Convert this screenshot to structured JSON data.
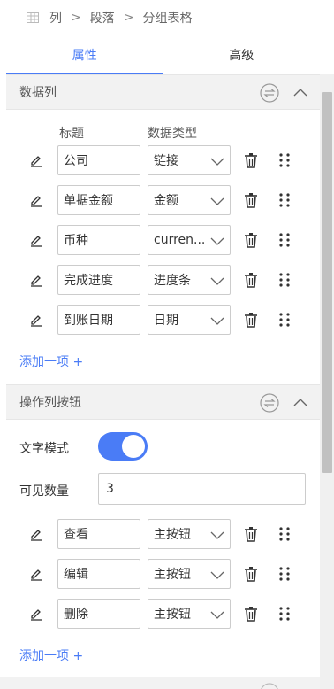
{
  "breadcrumb": {
    "items": [
      "列",
      "段落",
      "分组表格"
    ],
    "separator": ">"
  },
  "tabs": [
    {
      "label": "属性",
      "active": true
    },
    {
      "label": "高级",
      "active": false
    }
  ],
  "data_columns": {
    "title": "数据列",
    "header_title": "标题",
    "header_type": "数据类型",
    "rows": [
      {
        "title": "公司",
        "type": "链接"
      },
      {
        "title": "单据金额",
        "type": "金额"
      },
      {
        "title": "币种",
        "type": "curren..."
      },
      {
        "title": "完成进度",
        "type": "进度条"
      },
      {
        "title": "到账日期",
        "type": "日期"
      }
    ],
    "add_label": "添加一项 +"
  },
  "action_buttons": {
    "title": "操作列按钮",
    "text_mode_label": "文字模式",
    "text_mode_on": true,
    "visible_count_label": "可见数量",
    "visible_count_value": "3",
    "rows": [
      {
        "title": "查看",
        "type": "主按钮"
      },
      {
        "title": "编辑",
        "type": "主按钮"
      },
      {
        "title": "删除",
        "type": "主按钮"
      }
    ],
    "add_label": "添加一项 +"
  },
  "colors": {
    "accent": "#4a7cf6",
    "section_bg": "#f2f2f2",
    "icon": "#333333",
    "muted_icon": "#999999"
  },
  "icons": {
    "breadcrumb": "table-icon",
    "section_swap": "swap-circle-icon",
    "section_collapse": "chevron-up-icon",
    "row_edit": "pencil-icon",
    "row_select": "chevron-down-icon",
    "row_delete": "trash-icon",
    "row_drag": "drag-handle-icon"
  }
}
